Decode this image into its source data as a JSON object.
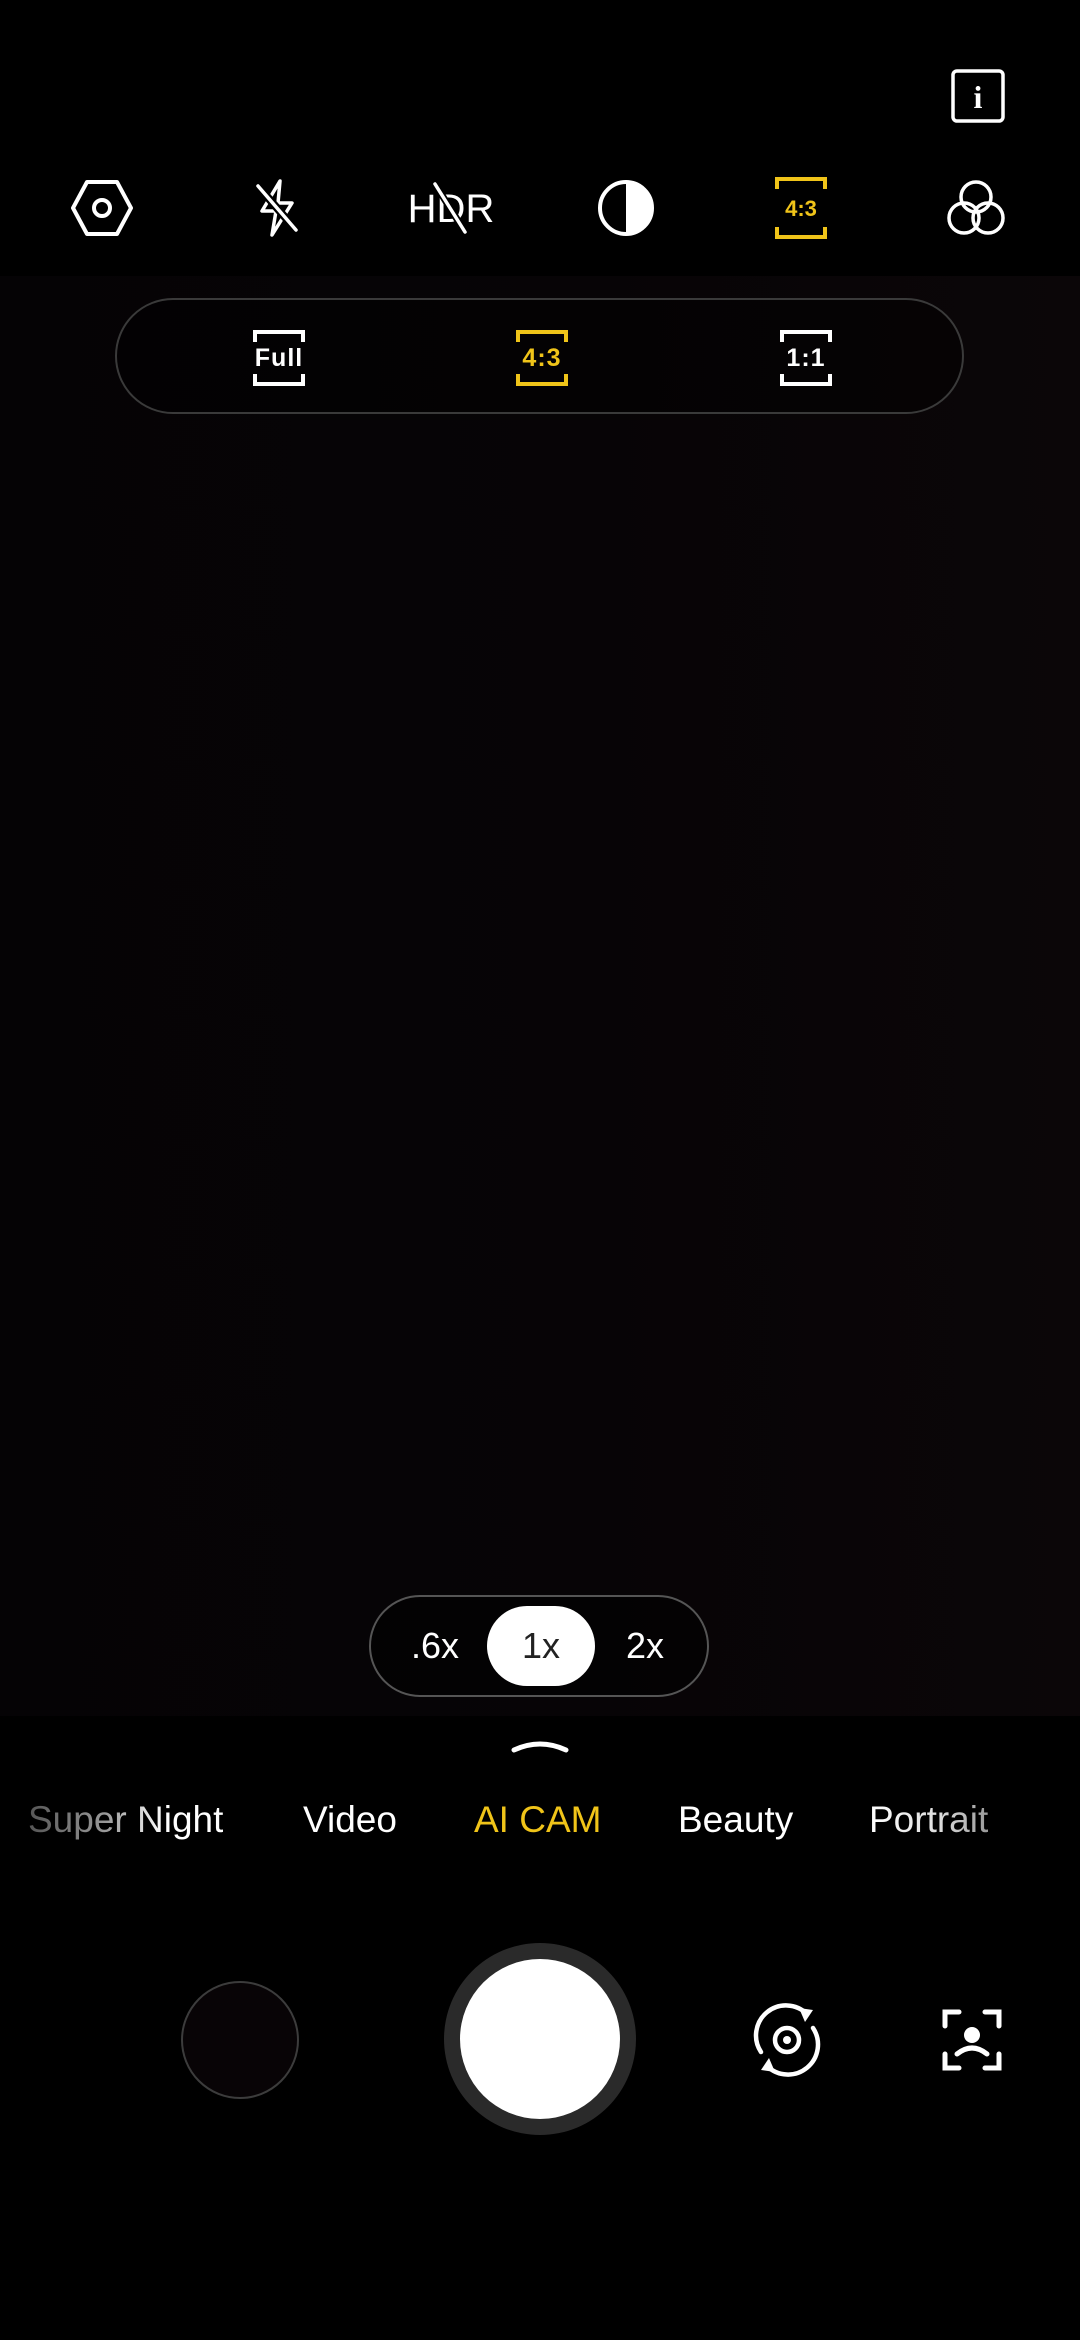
{
  "colors": {
    "accent": "#f0c419",
    "background": "#000000",
    "foreground": "#ffffff"
  },
  "top_toolbar": {
    "items": [
      {
        "icon": "settings-hexagon-icon"
      },
      {
        "icon": "flash-off-icon"
      },
      {
        "icon": "hdr-off-icon",
        "label": "HDR"
      },
      {
        "icon": "contrast-filter-icon"
      },
      {
        "icon": "aspect-ratio-icon",
        "label": "4:3",
        "active": true
      },
      {
        "icon": "color-filters-icon"
      }
    ]
  },
  "info_button": {
    "icon": "info-icon",
    "label": "i"
  },
  "ratio_panel": {
    "options": [
      {
        "label": "Full",
        "selected": false
      },
      {
        "label": "4:3",
        "selected": true
      },
      {
        "label": "1:1",
        "selected": false
      }
    ]
  },
  "zoom": {
    "options": [
      ".6x",
      "1x",
      "2x"
    ],
    "selected": "1x"
  },
  "modes": {
    "items": [
      "Super Night",
      "Video",
      "AI CAM",
      "Beauty",
      "Portrait"
    ],
    "active": "AI CAM"
  },
  "controls": {
    "gallery": "gallery-thumbnail",
    "shutter": "shutter-button",
    "flip": "camera-flip-icon",
    "lens": "lens-scan-icon"
  }
}
